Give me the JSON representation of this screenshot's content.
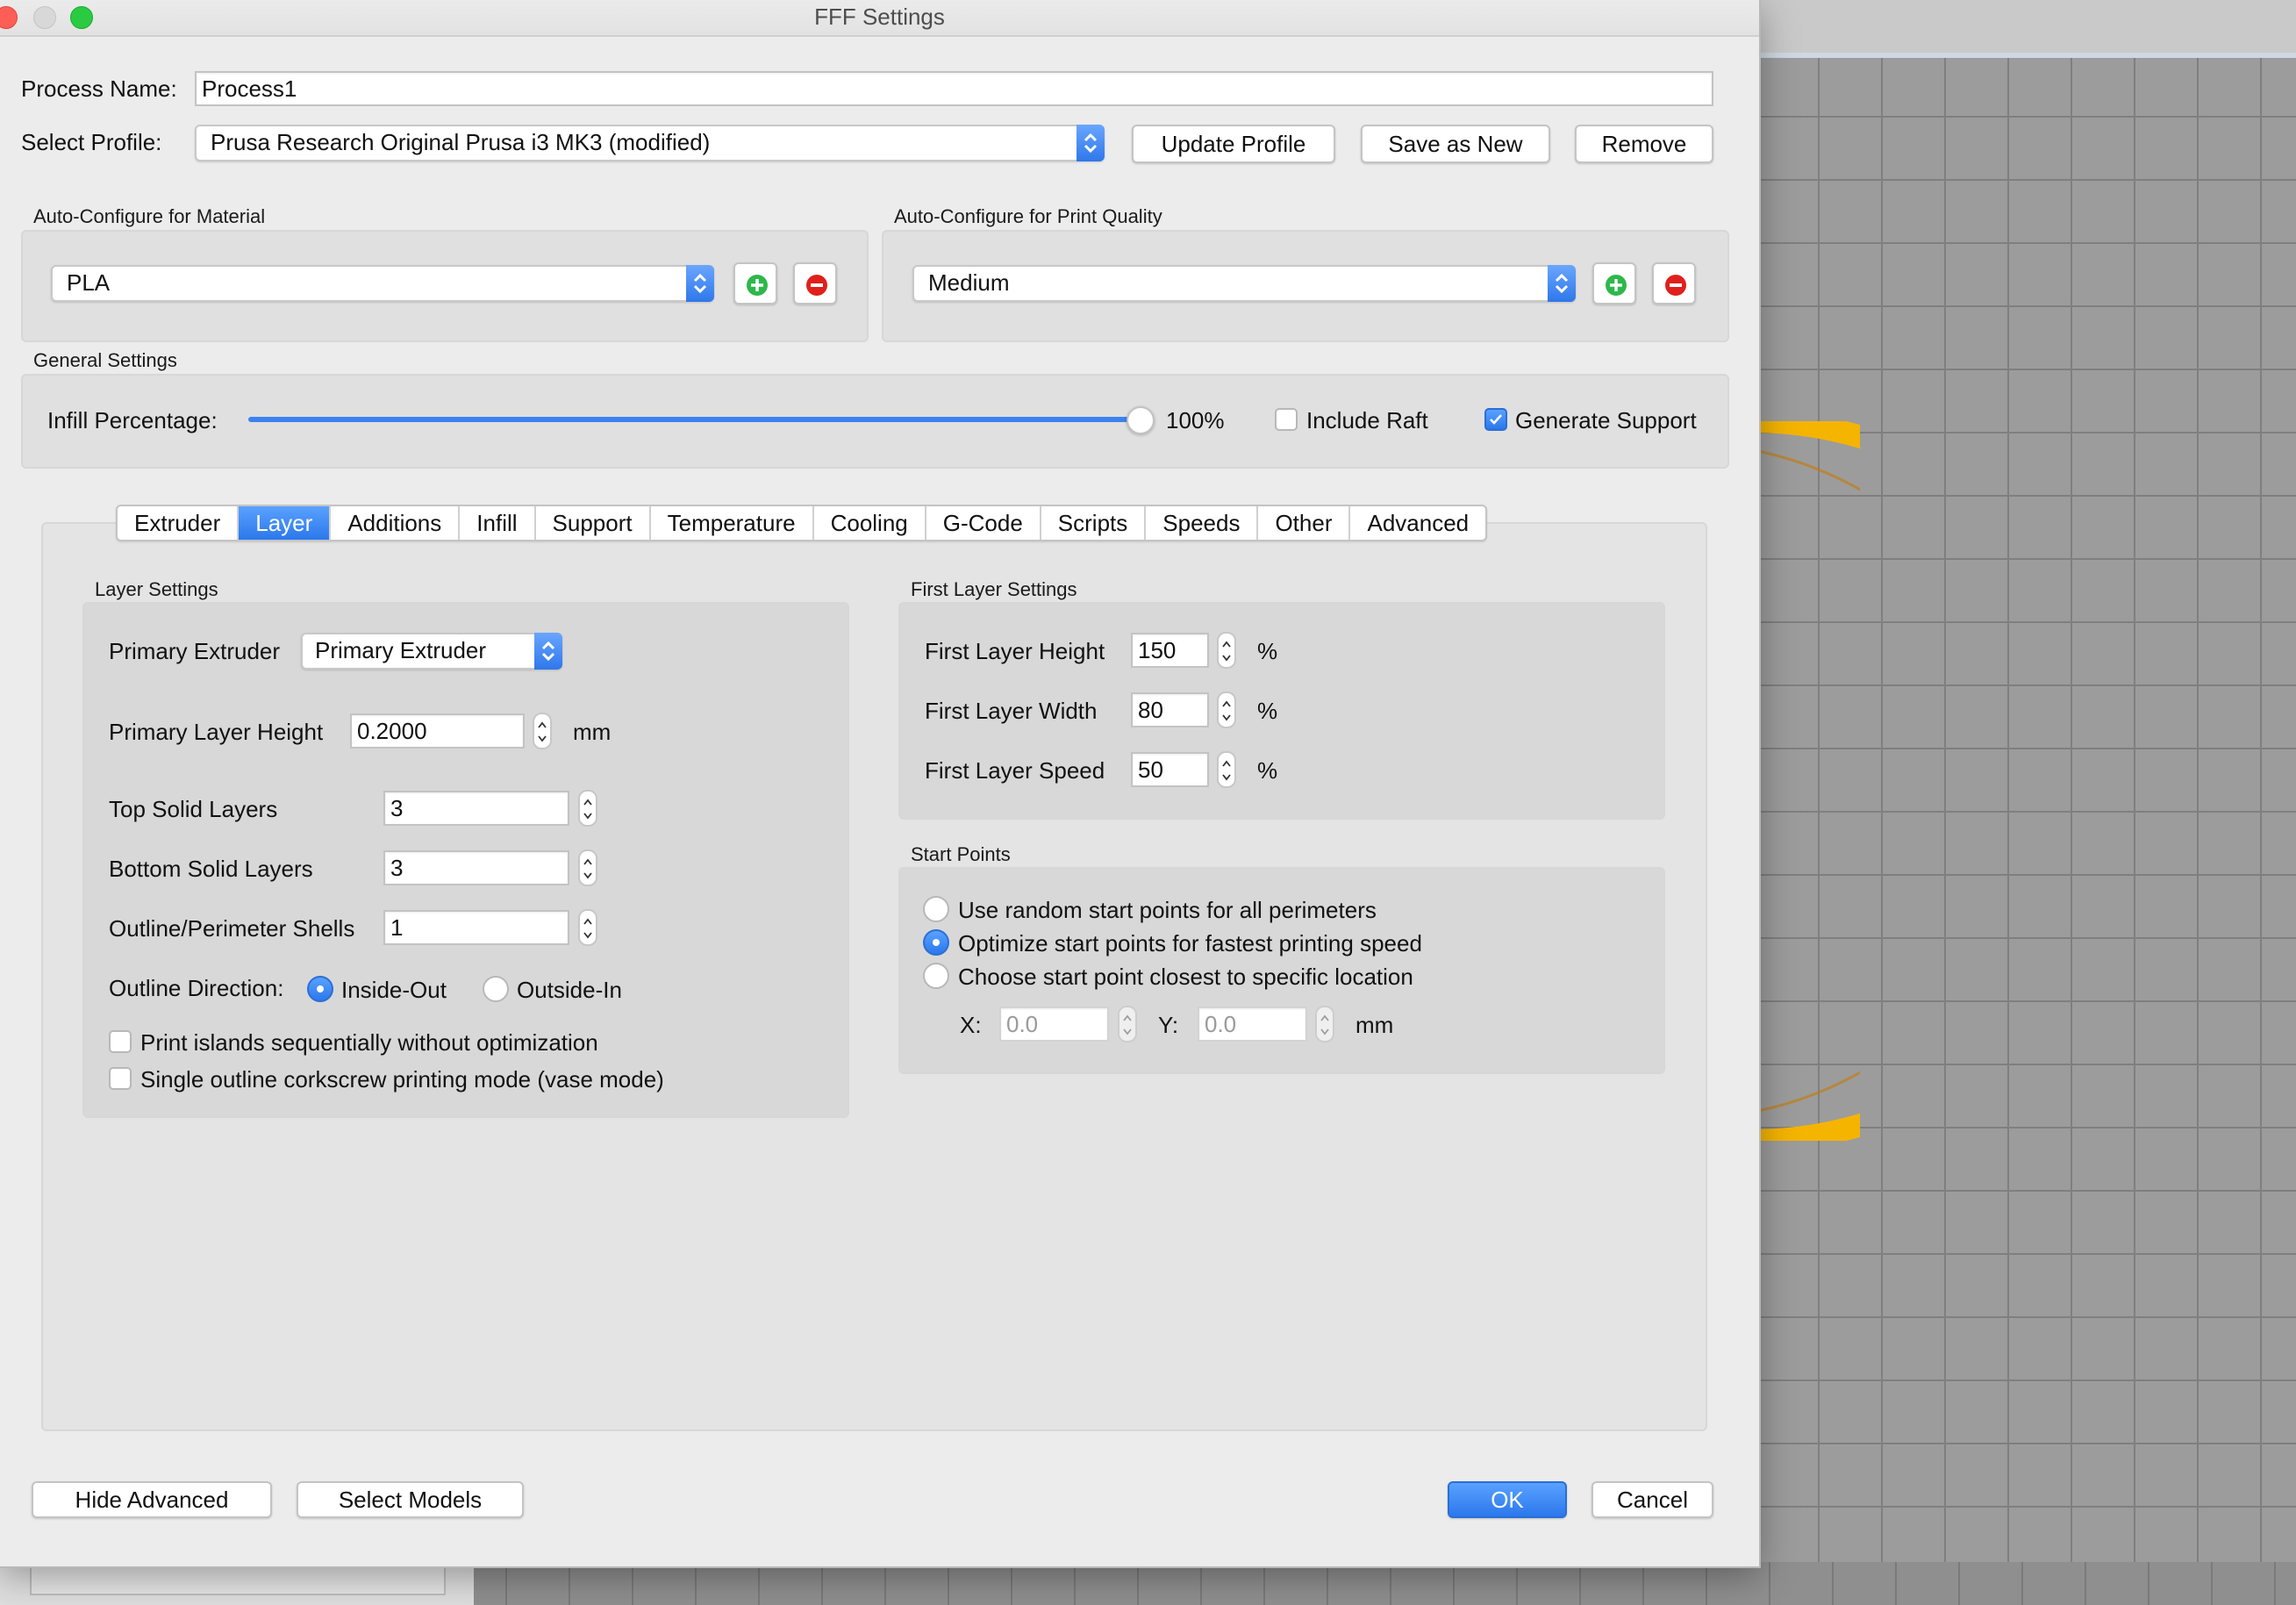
{
  "window": {
    "title": "FFF Settings"
  },
  "process": {
    "name_label": "Process Name:",
    "name_value": "Process1"
  },
  "profile": {
    "label": "Select Profile:",
    "selected": "Prusa Research Original Prusa i3 MK3 (modified)",
    "update_label": "Update Profile",
    "save_new_label": "Save as New",
    "remove_label": "Remove"
  },
  "material": {
    "section": "Auto-Configure for Material",
    "selected": "PLA"
  },
  "quality": {
    "section": "Auto-Configure for Print Quality",
    "selected": "Medium"
  },
  "general": {
    "section": "General Settings",
    "infill_label": "Infill Percentage:",
    "infill_value": "100%",
    "infill_fraction": 1.0,
    "raft_label": "Include Raft",
    "raft_checked": false,
    "support_label": "Generate Support",
    "support_checked": true
  },
  "tabs": [
    {
      "label": "Extruder"
    },
    {
      "label": "Layer",
      "active": true
    },
    {
      "label": "Additions"
    },
    {
      "label": "Infill"
    },
    {
      "label": "Support"
    },
    {
      "label": "Temperature"
    },
    {
      "label": "Cooling"
    },
    {
      "label": "G-Code"
    },
    {
      "label": "Scripts"
    },
    {
      "label": "Speeds"
    },
    {
      "label": "Other"
    },
    {
      "label": "Advanced"
    }
  ],
  "layer_settings": {
    "section": "Layer Settings",
    "primary_extruder_label": "Primary Extruder",
    "primary_extruder_value": "Primary Extruder",
    "layer_height_label": "Primary Layer Height",
    "layer_height_value": "0.2000",
    "layer_height_unit": "mm",
    "top_solid_label": "Top Solid Layers",
    "top_solid_value": "3",
    "bottom_solid_label": "Bottom Solid Layers",
    "bottom_solid_value": "3",
    "shells_label": "Outline/Perimeter Shells",
    "shells_value": "1",
    "direction_label": "Outline Direction:",
    "inside_out_label": "Inside-Out",
    "outside_in_label": "Outside-In",
    "print_islands_label": "Print islands sequentially without optimization",
    "vase_mode_label": "Single outline corkscrew printing mode (vase mode)"
  },
  "first_layer": {
    "section": "First Layer Settings",
    "height_label": "First Layer Height",
    "height_value": "150",
    "width_label": "First Layer Width",
    "width_value": "80",
    "speed_label": "First Layer Speed",
    "speed_value": "50",
    "unit": "%"
  },
  "start_points": {
    "section": "Start Points",
    "opt_random": "Use random start points for all perimeters",
    "opt_fastest": "Optimize start points for fastest printing speed",
    "opt_closest": "Choose start point closest to specific location",
    "x_label": "X:",
    "x_value": "0.0",
    "y_label": "Y:",
    "y_value": "0.0",
    "unit": "mm"
  },
  "footer": {
    "hide_advanced_label": "Hide Advanced",
    "select_models_label": "Select Models",
    "ok_label": "OK",
    "cancel_label": "Cancel"
  },
  "colors": {
    "accent": "#2b78ec",
    "ring": "#f5b400"
  }
}
